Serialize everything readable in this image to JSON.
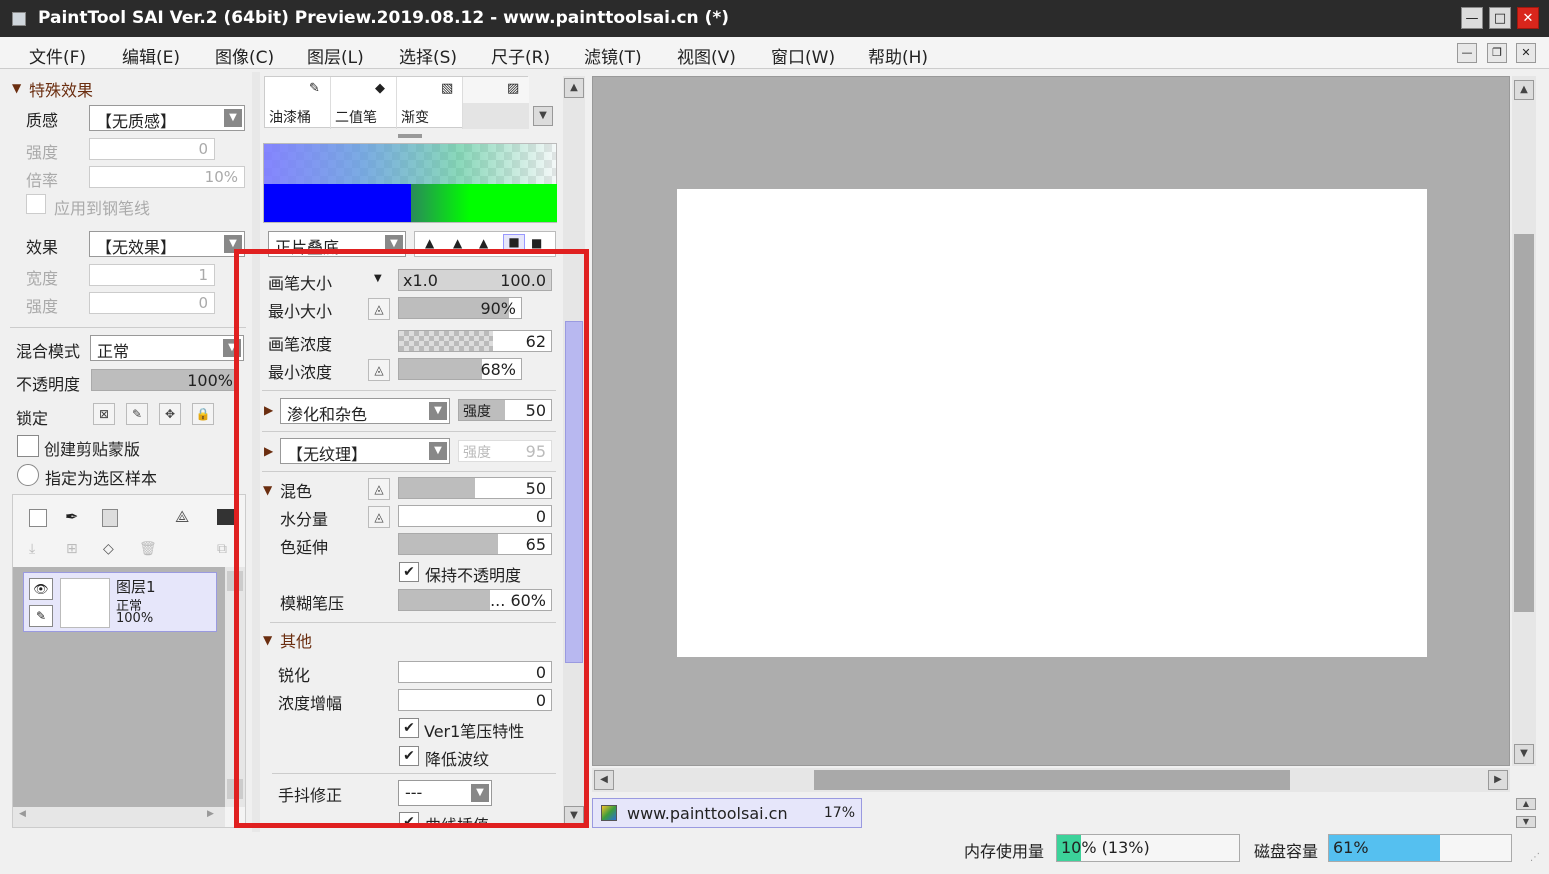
{
  "window": {
    "title": "PaintTool SAI Ver.2 (64bit) Preview.2019.08.12 - www.painttoolsai.cn (*)"
  },
  "menu": [
    "文件(F)",
    "编辑(E)",
    "图像(C)",
    "图层(L)",
    "选择(S)",
    "尺子(R)",
    "滤镜(T)",
    "视图(V)",
    "窗口(W)",
    "帮助(H)"
  ],
  "special": {
    "header": "特殊效果",
    "texture_label": "质感",
    "texture_value": "【无质感】",
    "strength_label": "强度",
    "strength_value": "0",
    "scale_label": "倍率",
    "scale_value": "10%",
    "apply_pen": "应用到钢笔线",
    "effect_label": "效果",
    "effect_value": "【无效果】",
    "width_label": "宽度",
    "width_value": "1",
    "strength2_label": "强度",
    "strength2_value": "0"
  },
  "layer_props": {
    "blend_label": "混合模式",
    "blend_value": "正常",
    "opacity_label": "不透明度",
    "opacity_value": "100%",
    "opacity_fraction": 1.0,
    "lock_label": "锁定",
    "clip_label": "创建剪贴蒙版",
    "sample_label": "指定为选区样本"
  },
  "layer": {
    "name": "图层1",
    "mode": "正常",
    "opacity": "100%"
  },
  "tools": {
    "slots": [
      "油漆桶",
      "二值笔",
      "渐变"
    ]
  },
  "brush": {
    "blend_mode": "正片叠底",
    "size_label": "画笔大小",
    "size_mult": "x1.0",
    "size_value": "100.0",
    "min_size_label": "最小大小",
    "min_size_value": "90%",
    "min_size_fraction": 0.9,
    "density_label": "画笔浓度",
    "density_value": "62",
    "density_fraction": 0.62,
    "min_density_label": "最小浓度",
    "min_density_value": "68%",
    "min_density_fraction": 0.68,
    "bleed_value": "渗化和杂色",
    "bleed_strength_label": "强度",
    "bleed_strength_value": "50",
    "texture_value": "【无纹理】",
    "texture_strength_label": "强度",
    "texture_strength_value": "95",
    "mix_header": "混色",
    "mix_value": "50",
    "mix_fraction": 0.5,
    "water_label": "水分量",
    "water_value": "0",
    "water_fraction": 0,
    "stretch_label": "色延伸",
    "stretch_value": "65",
    "stretch_fraction": 0.65,
    "keep_opacity": "保持不透明度",
    "blur_label": "模糊笔压",
    "blur_value": "... 60%",
    "blur_fraction": 0.6,
    "other_header": "其他",
    "sharpen_label": "锐化",
    "sharpen_value": "0",
    "density_amp_label": "浓度增幅",
    "density_amp_value": "0",
    "ver1_label": "Ver1笔压特性",
    "reduce_label": "降低波纹",
    "stabilizer_label": "手抖修正",
    "stabilizer_value": "---",
    "curve_label": "曲线插值"
  },
  "doc_tab": {
    "name": "www.painttoolsai.cn",
    "zoom": "17%"
  },
  "status": {
    "memory_label": "内存使用量",
    "memory_value": "10% (13%)",
    "memory_fraction": 0.13,
    "disk_label": "磁盘容量",
    "disk_value": "61%",
    "disk_fraction": 0.61
  },
  "colors": {
    "accent_red": "#e02020",
    "panel": "#f0f0f0",
    "canvas_bg": "#adadad",
    "layer_sel": "#e6e6fa",
    "progress_green": "#3cd29a",
    "progress_blue": "#55c0f0"
  }
}
